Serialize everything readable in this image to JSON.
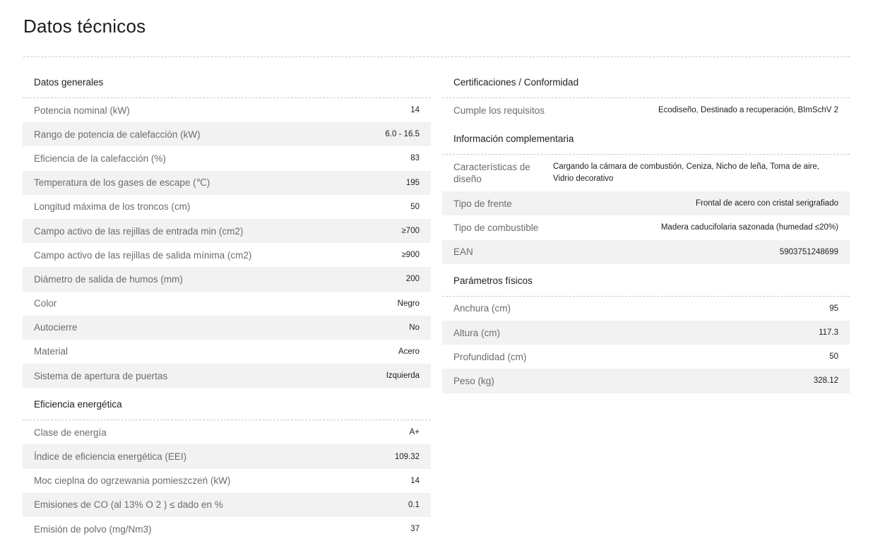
{
  "page": {
    "title": "Datos técnicos"
  },
  "left": {
    "general": {
      "title": "Datos generales",
      "rows": [
        {
          "label": "Potencia nominal (kW)",
          "value": "14"
        },
        {
          "label": "Rango de potencia de calefacción (kW)",
          "value": "6.0 - 16.5"
        },
        {
          "label": "Eficiencia de la calefacción (%)",
          "value": "83"
        },
        {
          "label": "Temperatura de los gases de escape (℃)",
          "value": "195"
        },
        {
          "label": "Longitud máxima de los troncos (cm)",
          "value": "50"
        },
        {
          "label": "Campo activo de las rejillas de entrada min (cm2)",
          "value": "≥700"
        },
        {
          "label": "Campo activo de las rejillas de salida mínima (cm2)",
          "value": "≥900"
        },
        {
          "label": "Diámetro de salida de humos (mm)",
          "value": "200"
        },
        {
          "label": "Color",
          "value": "Negro"
        },
        {
          "label": "Autocierre",
          "value": "No"
        },
        {
          "label": "Material",
          "value": "Acero"
        },
        {
          "label": "Sistema de apertura de puertas",
          "value": "Izquierda"
        }
      ]
    },
    "energy": {
      "title": "Eficiencia energética",
      "rows": [
        {
          "label": "Clase de energía",
          "value": "A+"
        },
        {
          "label": "Índice de eficiencia energética (EEI)",
          "value": "109.32"
        },
        {
          "label": "Moc cieplna do ogrzewania pomieszczeń (kW)",
          "value": "14"
        },
        {
          "label": "Emisiones de CO (al 13% O 2 ) ≤ dado en %",
          "value": "0.1"
        },
        {
          "label": "Emisión de polvo (mg/Nm3)",
          "value": "37"
        }
      ]
    }
  },
  "right": {
    "certs": {
      "title": "Certificaciones / Conformidad",
      "rows": [
        {
          "label": "Cumple los requisitos",
          "value": "Ecodiseño, Destinado a recuperación, BImSchV 2"
        }
      ]
    },
    "extra": {
      "title": "Información complementaria",
      "rows": [
        {
          "label": "Características de diseño",
          "value": "Cargando la cámara de combustión, Ceniza, Nicho de leña, Toma de aire, Vidrio decorativo"
        },
        {
          "label": "Tipo de frente",
          "value": "Frontal de acero con cristal serigrafiado"
        },
        {
          "label": "Tipo de combustible",
          "value": "Madera caducifolaria sazonada (humedad ≤20%)"
        },
        {
          "label": "EAN",
          "value": "5903751248699"
        }
      ]
    },
    "physical": {
      "title": "Parámetros físicos",
      "rows": [
        {
          "label": "Anchura (cm)",
          "value": "95"
        },
        {
          "label": "Altura (cm)",
          "value": "117.3"
        },
        {
          "label": "Profundidad (cm)",
          "value": "50"
        },
        {
          "label": "Peso (kg)",
          "value": "328.12"
        }
      ]
    }
  }
}
